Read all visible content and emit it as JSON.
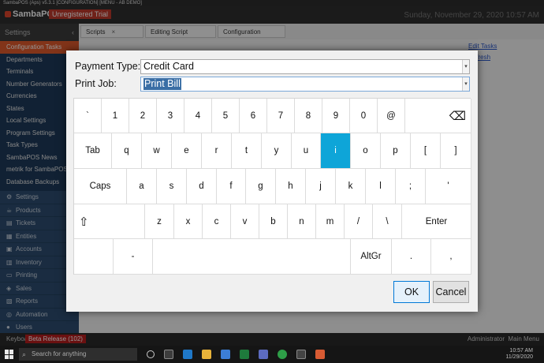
{
  "window": {
    "titlebar": "SambaPOS (Aps)  v5.3.1 [CONFIGURATION] [MENU - AB DEMO]"
  },
  "header": {
    "logo": "SambaPOS",
    "trial_badge": "Unregistered Trial",
    "clock": "Sunday, November 29, 2020 10:57 AM"
  },
  "sidebar": {
    "section_label": "Settings",
    "items": [
      {
        "label": "Configuration Tasks",
        "active": true
      },
      {
        "label": "Departments"
      },
      {
        "label": "Terminals"
      },
      {
        "label": "Number Generators"
      },
      {
        "label": "Currencies"
      },
      {
        "label": "States"
      },
      {
        "label": "Local Settings"
      },
      {
        "label": "Program Settings"
      },
      {
        "label": "Task Types"
      },
      {
        "label": "SambaPOS News"
      },
      {
        "label": "metrik for SambaPOS"
      },
      {
        "label": "Database Backups"
      }
    ],
    "nav": [
      {
        "label": "Settings",
        "icon": "gear-icon",
        "glyph": "⚙"
      },
      {
        "label": "Products",
        "icon": "cup-icon",
        "glyph": "☕"
      },
      {
        "label": "Tickets",
        "icon": "ticket-icon",
        "glyph": "▤"
      },
      {
        "label": "Entities",
        "icon": "folder-icon",
        "glyph": "▦"
      },
      {
        "label": "Accounts",
        "icon": "calculator-icon",
        "glyph": "▣"
      },
      {
        "label": "Inventory",
        "icon": "box-icon",
        "glyph": "▥"
      },
      {
        "label": "Printing",
        "icon": "printer-icon",
        "glyph": "▭"
      },
      {
        "label": "Sales",
        "icon": "tag-icon",
        "glyph": "◈"
      },
      {
        "label": "Reports",
        "icon": "chart-icon",
        "glyph": "▧"
      },
      {
        "label": "Automation",
        "icon": "automation-icon",
        "glyph": "◎"
      },
      {
        "label": "Users",
        "icon": "users-icon",
        "glyph": "●"
      }
    ]
  },
  "tabs": [
    {
      "label": "Scripts"
    },
    {
      "label": "Editing Script (Studio)"
    },
    {
      "label": "Configuration Tasks"
    }
  ],
  "content": {
    "links": [
      "Edit Tasks",
      "Refresh"
    ]
  },
  "statusbar": {
    "keyboard": "Keyboard",
    "beta": "Beta Release (102)",
    "user": "Administrator",
    "main_menu": "Main Menu"
  },
  "taskbar": {
    "search_placeholder": "Search for anything",
    "time": "10:57 AM",
    "date": "11/29/2020"
  },
  "dialog": {
    "payment_type_label": "Payment Type:",
    "payment_type_value": "Credit Card",
    "print_job_label": "Print Job:",
    "print_job_value": "Print Bill",
    "ok_label": "OK",
    "cancel_label": "Cancel"
  },
  "keyboard": {
    "highlighted_key": "i",
    "rows": [
      [
        "`",
        "1",
        "2",
        "3",
        "4",
        "5",
        "6",
        "7",
        "8",
        "9",
        "0",
        "@",
        "⌫"
      ],
      [
        "Tab",
        "q",
        "w",
        "e",
        "r",
        "t",
        "y",
        "u",
        "i",
        "o",
        "p",
        "[",
        "]"
      ],
      [
        "Caps",
        "a",
        "s",
        "d",
        "f",
        "g",
        "h",
        "j",
        "k",
        "l",
        ";",
        "'"
      ],
      [
        "⇧",
        "z",
        "x",
        "c",
        "v",
        "b",
        "n",
        "m",
        "/",
        "\\",
        "Enter"
      ],
      [
        "",
        "-",
        "",
        "AltGr",
        ".",
        ","
      ]
    ]
  },
  "colors": {
    "accent": "#0ea5d8",
    "sidebar": "#1e3a5a",
    "active": "#e05a2b",
    "trial": "#c0392b"
  }
}
